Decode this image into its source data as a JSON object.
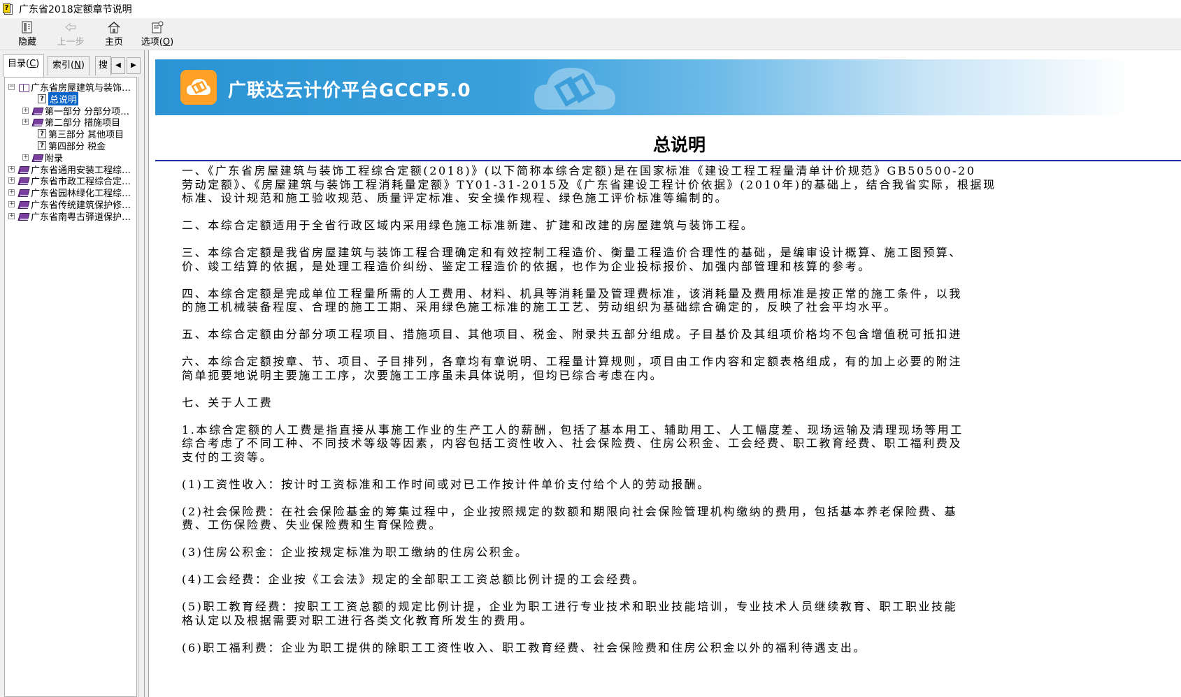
{
  "window": {
    "title": "广东省2018定额章节说明"
  },
  "toolbar": {
    "hide_label": "隐藏",
    "back_label": "上一步",
    "home_label": "主页",
    "options_label": "选项(",
    "options_key": "O",
    "options_tail": ")"
  },
  "tabs": {
    "contents_label": "目录(",
    "contents_key": "C",
    "contents_tail": ")",
    "index_label": "索引(",
    "index_key": "N",
    "index_tail": ")",
    "search_label": "搜"
  },
  "tree": [
    {
      "label": "广东省房屋建筑与装饰…",
      "expand": "−",
      "icon": "book-open",
      "indent": 0
    },
    {
      "label": "总说明",
      "expand": "",
      "icon": "help-page",
      "indent": 2,
      "selected": true
    },
    {
      "label": "第一部分  分部分项…",
      "expand": "+",
      "icon": "book-closed",
      "indent": 1
    },
    {
      "label": "第二部分  措施项目",
      "expand": "+",
      "icon": "book-closed",
      "indent": 1
    },
    {
      "label": "第三部分  其他项目",
      "expand": "",
      "icon": "help-page",
      "indent": 2
    },
    {
      "label": "第四部分  税金",
      "expand": "",
      "icon": "help-page",
      "indent": 2
    },
    {
      "label": "附录",
      "expand": "+",
      "icon": "book-closed",
      "indent": 1
    },
    {
      "label": "广东省通用安装工程综…",
      "expand": "+",
      "icon": "book-closed",
      "indent": 0
    },
    {
      "label": "广东省市政工程综合定…",
      "expand": "+",
      "icon": "book-closed",
      "indent": 0
    },
    {
      "label": "广东省园林绿化工程综…",
      "expand": "+",
      "icon": "book-closed",
      "indent": 0
    },
    {
      "label": "广东省传统建筑保护修…",
      "expand": "+",
      "icon": "book-closed",
      "indent": 0
    },
    {
      "label": "广东省南粤古驿道保护…",
      "expand": "+",
      "icon": "book-closed",
      "indent": 0
    }
  ],
  "banner": {
    "title": "广联达云计价平台GCCP5.0"
  },
  "document": {
    "title": "总说明",
    "lines": [
      "一、《广东省房屋建筑与装饰工程综合定额(2018)》(以下简称本综合定额)是在国家标准《建设工程工程量清单计价规范》GB50500-20",
      "劳动定额》、《房屋建筑与装饰工程消耗量定额》TY01-31-2015及《广东省建设工程计价依据》(2010年)的基础上，结合我省实际，根据现",
      "标准、设计规范和施工验收规范、质量评定标准、安全操作规程、绿色施工评价标准等编制的。",
      "",
      "二、本综合定额适用于全省行政区域内采用绿色施工标准新建、扩建和改建的房屋建筑与装饰工程。",
      "",
      "三、本综合定额是我省房屋建筑与装饰工程合理确定和有效控制工程造价、衡量工程造价合理性的基础，是编审设计概算、施工图预算、",
      "价、竣工结算的依据，是处理工程造价纠纷、鉴定工程造价的依据，也作为企业投标报价、加强内部管理和核算的参考。",
      "",
      "四、本综合定额是完成单位工程量所需的人工费用、材料、机具等消耗量及管理费标准，该消耗量及费用标准是按正常的施工条件，以我",
      "的施工机械装备程度、合理的施工工期、采用绿色施工标准的施工工艺、劳动组织为基础综合确定的，反映了社会平均水平。",
      "",
      "五、本综合定额由分部分项工程项目、措施项目、其他项目、税金、附录共五部分组成。子目基价及其组项价格均不包含增值税可抵扣进",
      "",
      "六、本综合定额按章、节、项目、子目排列，各章均有章说明、工程量计算规则，项目由工作内容和定额表格组成，有的加上必要的附注",
      "简单扼要地说明主要施工工序，次要施工工序虽未具体说明，但均已综合考虑在内。",
      "",
      "七、关于人工费",
      "",
      "1.本综合定额的人工费是指直接从事施工作业的生产工人的薪酬，包括了基本用工、辅助用工、人工幅度差、现场运输及清理现场等用工",
      "综合考虑了不同工种、不同技术等级等因素，内容包括工资性收入、社会保险费、住房公积金、工会经费、职工教育经费、职工福利费及",
      "支付的工资等。",
      "",
      "(1)工资性收入：按计时工资标准和工作时间或对已工作按计件单价支付给个人的劳动报酬。",
      "",
      "(2)社会保险费：在社会保险基金的筹集过程中，企业按照规定的数额和期限向社会保险管理机构缴纳的费用，包括基本养老保险费、基",
      "费、工伤保险费、失业保险费和生育保险费。",
      "",
      "(3)住房公积金：企业按规定标准为职工缴纳的住房公积金。",
      "",
      "(4)工会经费：企业按《工会法》规定的全部职工工资总额比例计提的工会经费。",
      "",
      "(5)职工教育经费：按职工工资总额的规定比例计提，企业为职工进行专业技术和职业技能培训，专业技术人员继续教育、职工职业技能",
      "格认定以及根据需要对职工进行各类文化教育所发生的费用。",
      "",
      "(6)职工福利费：企业为职工提供的除职工工资性收入、职工教育经费、社会保险费和住房公积金以外的福利待遇支出。"
    ]
  }
}
